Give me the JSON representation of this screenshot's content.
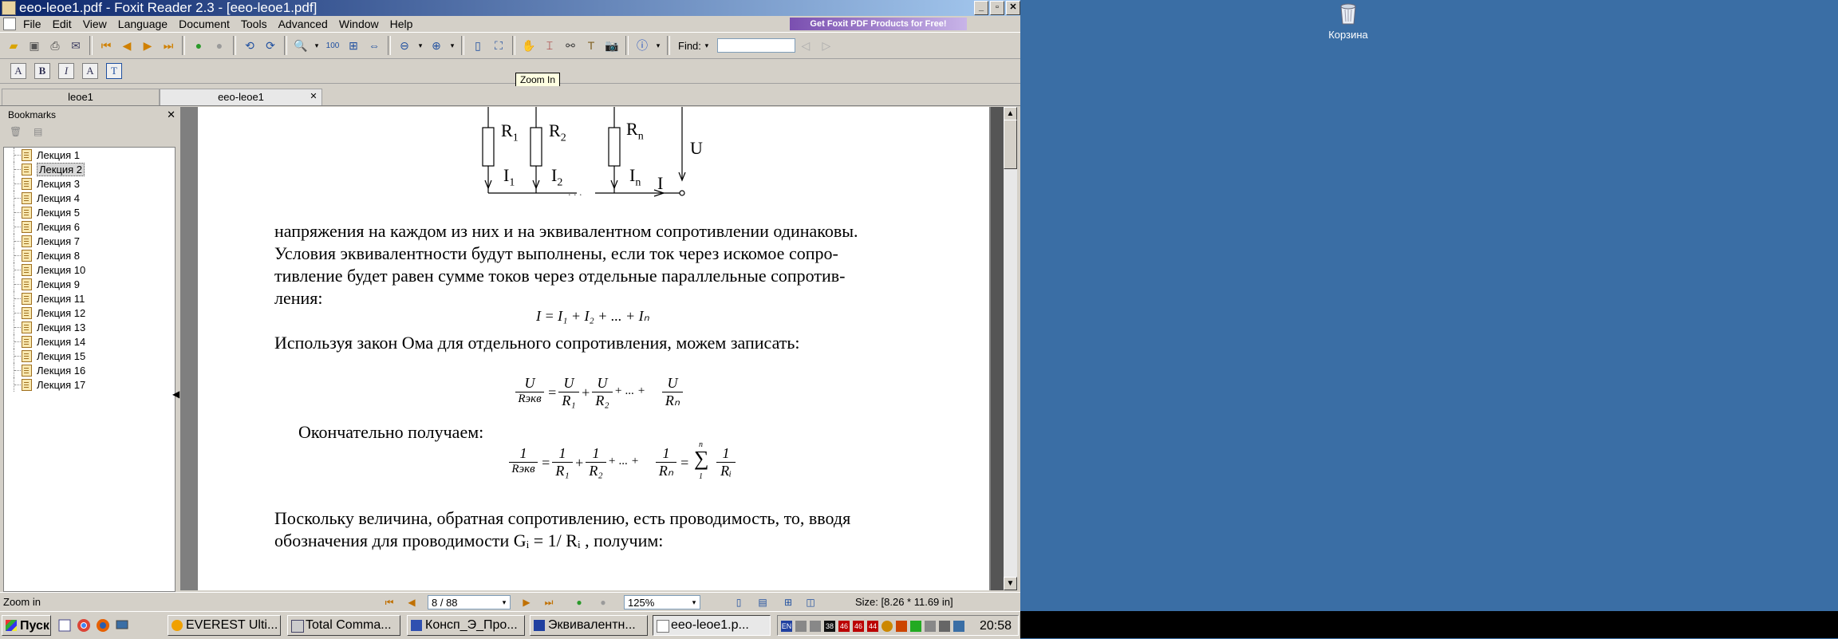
{
  "window": {
    "title": "eeo-leoe1.pdf - Foxit Reader 2.3 - [eeo-leoe1.pdf]"
  },
  "menu": [
    "File",
    "Edit",
    "View",
    "Language",
    "Document",
    "Tools",
    "Advanced",
    "Window",
    "Help"
  ],
  "promo_banner": "Get Foxit PDF Products for Free!",
  "find": {
    "label": "Find:",
    "value": ""
  },
  "tooltip": "Zoom In",
  "tabs": [
    {
      "label": "leoe1"
    },
    {
      "label": "eeo-leoe1"
    }
  ],
  "bookmarks": {
    "title": "Bookmarks",
    "items": [
      "Лекция 1",
      "Лекция 2",
      "Лекция 3",
      "Лекция 4",
      "Лекция 5",
      "Лекция 6",
      "Лекция 7",
      "Лекция 8",
      "Лекция 10",
      "Лекция 9",
      "Лекция 11",
      "Лекция 12",
      "Лекция 13",
      "Лекция 14",
      "Лекция 15",
      "Лекция 16",
      "Лекция 17"
    ],
    "selected_index": 1
  },
  "page": {
    "circuit": {
      "r1": "R",
      "r1_sub": "1",
      "r2": "R",
      "r2_sub": "2",
      "rn": "R",
      "rn_sub": "n",
      "i1": "I",
      "i1_sub": "1",
      "i2": "I",
      "i2_sub": "2",
      "in": "I",
      "in_sub": "n",
      "i": "I",
      "u": "U",
      "dots": ". . ."
    },
    "p1": [
      "напряжения на каждом из них и на эквивалентном сопротивлении  одинаковы.",
      "Условия  эквивалентности  будут выполнены,  если ток через искомое сопро-",
      "тивление будет равен сумме  токов  через  отдельные  параллельные сопротив-",
      "ления:"
    ],
    "eq1": "I = I₁ + I₂ + ... + Iₙ",
    "p2": "Используя закон Ома для отдельного сопротивления, можем записать:",
    "eq2": {
      "lhs_num": "U",
      "lhs_den": "Rэкв",
      "t1_num": "U",
      "t1_den": "R₁",
      "t2_num": "U",
      "t2_den": "R₂",
      "tn_num": "U",
      "tn_den": "Rₙ",
      "eq": "=",
      "plus": "+",
      "dots": "+ ... +"
    },
    "p3": "Окончательно получаем:",
    "eq3": {
      "lhs_num": "1",
      "lhs_den": "Rэкв",
      "t1_num": "1",
      "t1_den": "R₁",
      "t2_num": "1",
      "t2_den": "R₂",
      "tn_num": "1",
      "tn_den": "Rₙ",
      "eq": "=",
      "plus": "+",
      "dots": "+ ... +",
      "sum_top": "n",
      "sum_bottom": "1",
      "sum_num": "1",
      "sum_den": "Rᵢ",
      "sigma": "∑"
    },
    "p4": [
      "Поскольку величина,  обратная  сопротивлению,  есть проводимость,  то, вводя",
      "обозначения для проводимости  Gᵢ = 1/ Rᵢ , получим:"
    ]
  },
  "status": {
    "left": "Zoom in",
    "page": "8 / 88",
    "zoom": "125%",
    "size": "Size: [8.26 * 11.69 in]"
  },
  "taskbar": {
    "start": "Пуск",
    "tasks": [
      "EVEREST Ulti...",
      "Total Comma...",
      "Консп_Э_Про...",
      "Эквивалентн...",
      "eeo-leoe1.p..."
    ],
    "lang": "EN",
    "tray_nums": [
      "38",
      "46",
      "46",
      "44"
    ],
    "clock": "20:58"
  },
  "desktop": {
    "recycle_bin": "Корзина"
  }
}
